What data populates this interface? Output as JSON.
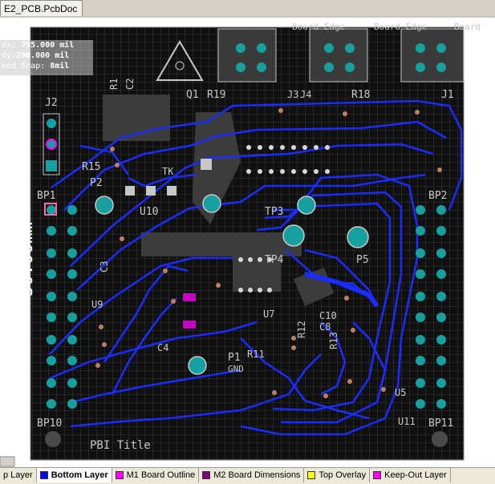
{
  "document": {
    "tab_title": "E2_PCB.PcbDoc"
  },
  "hud": {
    "dx_label": "dx:",
    "dx_value": "795.000 mil",
    "dy_label": "dy:",
    "dy_value": "290.000 mil",
    "snap_label": "ood Snap:",
    "snap_value": "8mil"
  },
  "board": {
    "dimension_label": "50.00mm",
    "edge_labels": [
      "Board Edge",
      "Board Edge",
      "Board E"
    ],
    "designators": {
      "j2": "J2",
      "j1": "J1",
      "j3": "J3",
      "j4": "J4",
      "bp1": "BP1",
      "bp2": "BP2",
      "bp10": "BP10",
      "bp11": "BP11",
      "p2": "P2",
      "p1": "P1",
      "p5": "P5",
      "u10": "U10",
      "u9": "U9",
      "u7": "U7",
      "u5": "U5",
      "u11": "U11",
      "tp3": "TP3",
      "tp4": "TP4",
      "q1": "Q1",
      "r19": "R19",
      "r18": "R18",
      "r15": "R15",
      "r12": "R12",
      "r13": "R13",
      "r11": "R11",
      "c2": "C2",
      "c3": "C3",
      "c4": "C4",
      "c8": "C8",
      "c10": "C10",
      "r1": "R1",
      "gnd": "GND",
      "pbi_title": "PBI Title",
      "tp_misc": "TK"
    },
    "colors": {
      "board": "#101010",
      "grid": "#5a5a5a",
      "trace": "#1a2cff",
      "pad": "#17a0a0",
      "via": "#c08060",
      "silk": "#c8c8c8",
      "outline": "#ff00ff"
    }
  },
  "layer_tabs": [
    {
      "label": "p Layer",
      "color": "",
      "active": false
    },
    {
      "label": "Bottom Layer",
      "color": "#0000ff",
      "active": true
    },
    {
      "label": "M1 Board Outline",
      "color": "#ff00ff",
      "active": false
    },
    {
      "label": "M2 Board Dimensions",
      "color": "#800080",
      "active": false
    },
    {
      "label": "Top Overlay",
      "color": "#ffff00",
      "active": false
    },
    {
      "label": "Keep-Out Layer",
      "color": "#ff00ff",
      "active": false
    }
  ]
}
